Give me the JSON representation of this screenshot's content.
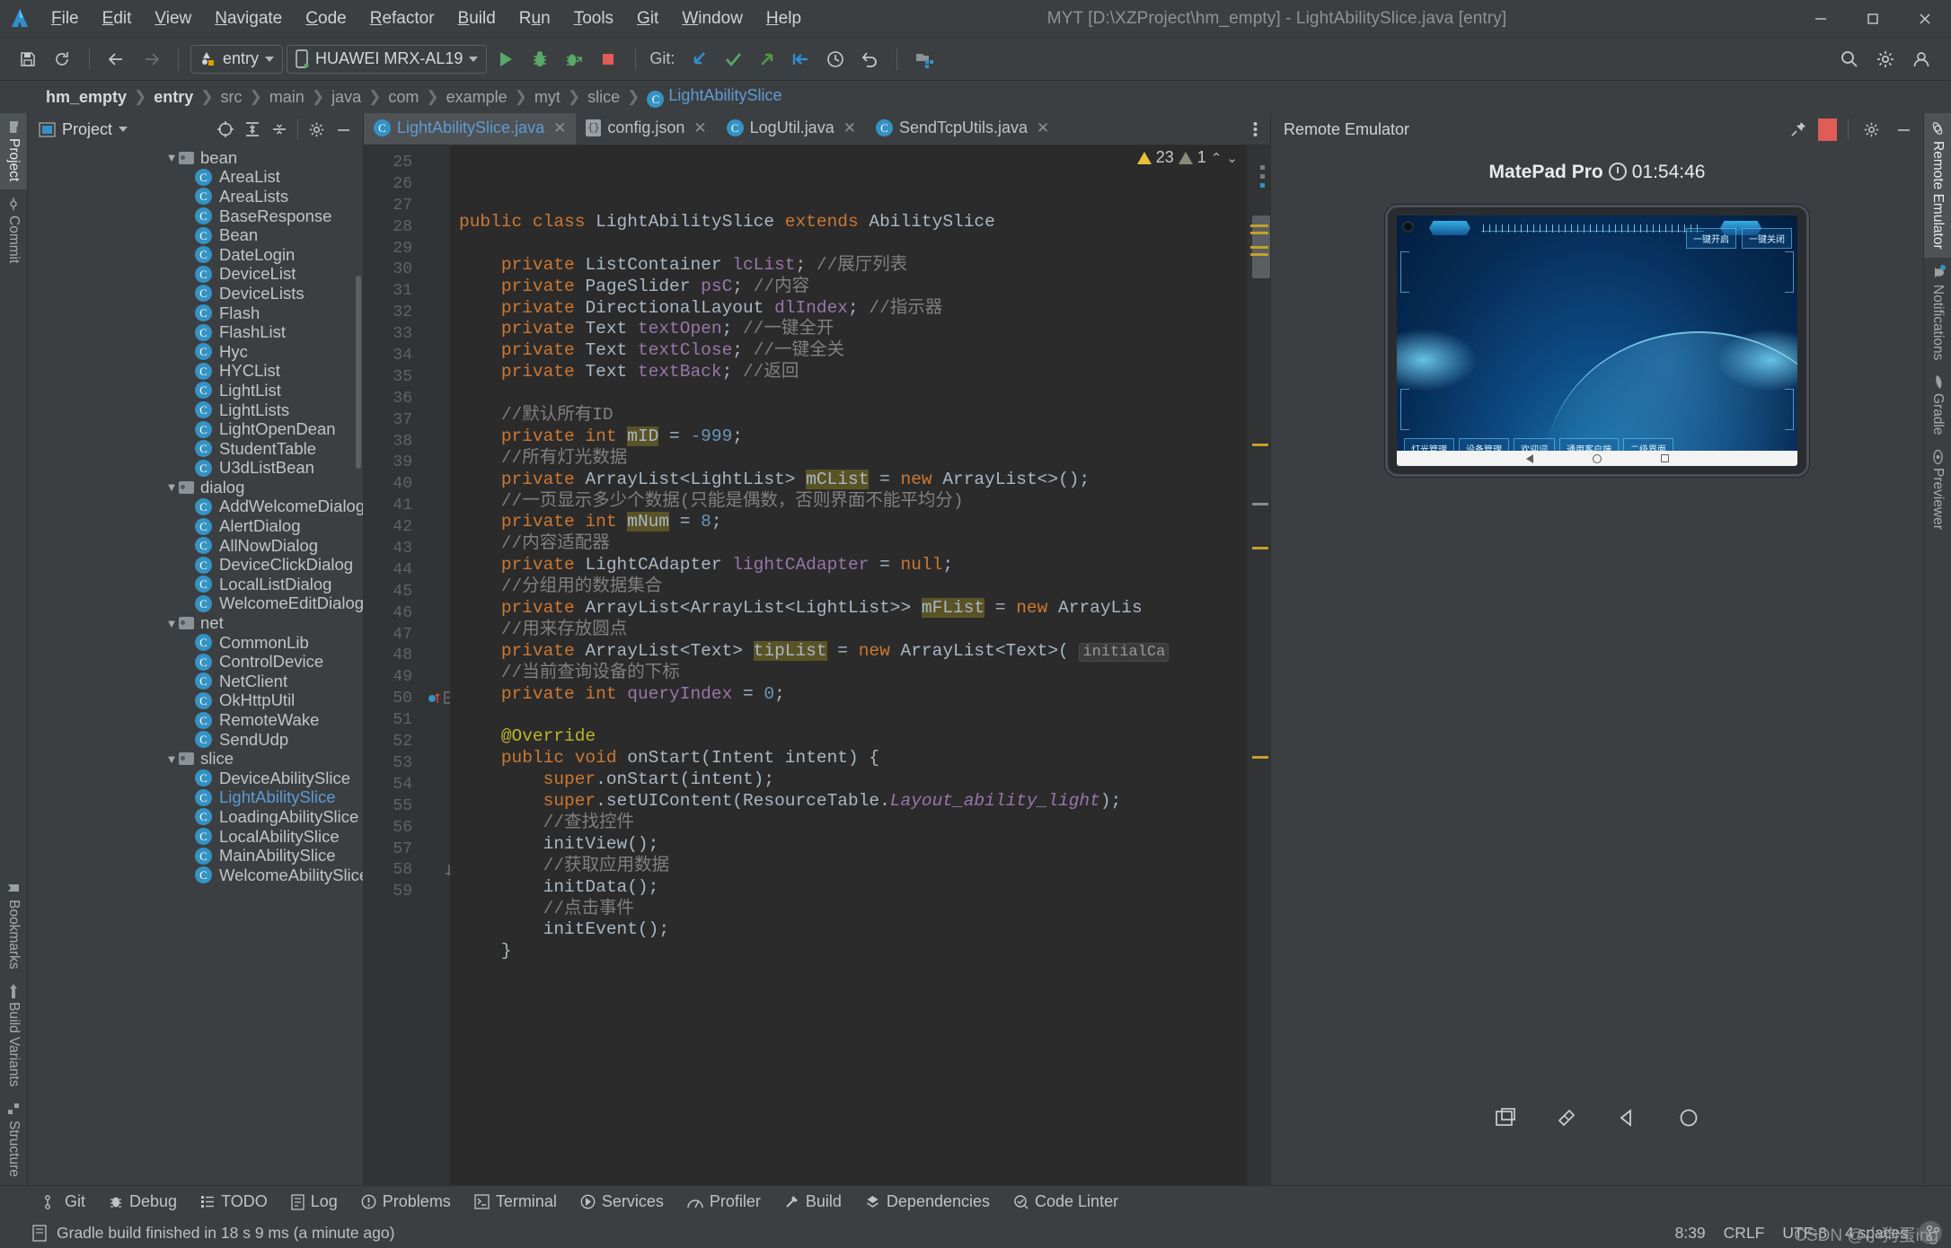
{
  "window": {
    "title": "MYT [D:\\XZProject\\hm_empty] - LightAbilitySlice.java [entry]",
    "minimize": "—",
    "maximize": "▢",
    "close": "✕"
  },
  "menu": [
    "File",
    "Edit",
    "View",
    "Navigate",
    "Code",
    "Refactor",
    "Build",
    "Run",
    "Tools",
    "Git",
    "Window",
    "Help"
  ],
  "toolbar": {
    "save_icon": "save-icon",
    "sync_icon": "sync-icon",
    "back_icon": "back-arrow-icon",
    "forward_icon": "forward-arrow-icon",
    "run_config": "entry",
    "device": "HUAWEI MRX-AL19",
    "run_icon": "run-icon",
    "debug_icon": "debug-icon",
    "debug_attach_icon": "attach-debugger-icon",
    "stop_icon": "stop-icon",
    "git_label": "Git:",
    "git_update_icon": "update-project-icon",
    "git_commit_icon": "commit-icon",
    "git_push_icon": "push-icon",
    "git_pull_icon": "pull-icon",
    "history_icon": "history-icon",
    "undo_icon": "undo-icon",
    "project_structure_icon": "project-structure-icon",
    "search_icon": "search-everywhere-icon",
    "settings_icon": "settings-icon",
    "account_icon": "account-icon"
  },
  "breadcrumb": [
    "hm_empty",
    "entry",
    "src",
    "main",
    "java",
    "com",
    "example",
    "myt",
    "slice",
    "LightAbilitySlice"
  ],
  "left_tabs": [
    {
      "label": "Project",
      "icon": "project-folder-icon",
      "active": true
    },
    {
      "label": "Commit",
      "icon": "commit-icon",
      "active": false
    },
    {
      "label": "Bookmarks",
      "icon": "bookmark-icon",
      "active": false
    },
    {
      "label": "Build Variants",
      "icon": "build-variants-icon",
      "active": false
    },
    {
      "label": "Structure",
      "icon": "structure-icon",
      "active": false
    }
  ],
  "right_tabs": [
    {
      "label": "Remote Emulator",
      "icon": "remote-emulator-icon",
      "active": true
    },
    {
      "label": "Notifications",
      "icon": "bell-icon",
      "active": false,
      "badge": true
    },
    {
      "label": "Gradle",
      "icon": "gradle-elephant-icon",
      "active": false
    },
    {
      "label": "Previewer",
      "icon": "eye-icon",
      "active": false
    }
  ],
  "project_panel": {
    "title": "Project",
    "select_icon": "select-opened-file-icon",
    "expand_icon": "expand-all-icon",
    "collapse_icon": "collapse-all-icon",
    "settings_icon": "gear-icon",
    "hide_icon": "hide-panel-icon",
    "tree": [
      {
        "label": "bean",
        "type": "folder",
        "depth": 1,
        "expanded": true
      },
      {
        "label": "AreaList",
        "type": "class",
        "depth": 2
      },
      {
        "label": "AreaLists",
        "type": "class",
        "depth": 2
      },
      {
        "label": "BaseResponse",
        "type": "class",
        "depth": 2
      },
      {
        "label": "Bean",
        "type": "class",
        "depth": 2
      },
      {
        "label": "DateLogin",
        "type": "class",
        "depth": 2
      },
      {
        "label": "DeviceList",
        "type": "class",
        "depth": 2
      },
      {
        "label": "DeviceLists",
        "type": "class",
        "depth": 2
      },
      {
        "label": "Flash",
        "type": "class",
        "depth": 2
      },
      {
        "label": "FlashList",
        "type": "class",
        "depth": 2
      },
      {
        "label": "Hyc",
        "type": "class",
        "depth": 2
      },
      {
        "label": "HYCList",
        "type": "class",
        "depth": 2
      },
      {
        "label": "LightList",
        "type": "class",
        "depth": 2
      },
      {
        "label": "LightLists",
        "type": "class",
        "depth": 2
      },
      {
        "label": "LightOpenDean",
        "type": "class",
        "depth": 2
      },
      {
        "label": "StudentTable",
        "type": "class",
        "depth": 2
      },
      {
        "label": "U3dListBean",
        "type": "class",
        "depth": 2
      },
      {
        "label": "dialog",
        "type": "folder",
        "depth": 1,
        "expanded": true
      },
      {
        "label": "AddWelcomeDialog",
        "type": "class",
        "depth": 2
      },
      {
        "label": "AlertDialog",
        "type": "class",
        "depth": 2
      },
      {
        "label": "AllNowDialog",
        "type": "class",
        "depth": 2
      },
      {
        "label": "DeviceClickDialog",
        "type": "class",
        "depth": 2
      },
      {
        "label": "LocalListDialog",
        "type": "class",
        "depth": 2
      },
      {
        "label": "WelcomeEditDialog",
        "type": "class",
        "depth": 2
      },
      {
        "label": "net",
        "type": "folder",
        "depth": 1,
        "expanded": true
      },
      {
        "label": "CommonLib",
        "type": "class",
        "depth": 2
      },
      {
        "label": "ControlDevice",
        "type": "class",
        "depth": 2
      },
      {
        "label": "NetClient",
        "type": "class",
        "depth": 2
      },
      {
        "label": "OkHttpUtil",
        "type": "class",
        "depth": 2
      },
      {
        "label": "RemoteWake",
        "type": "class",
        "depth": 2
      },
      {
        "label": "SendUdp",
        "type": "class",
        "depth": 2
      },
      {
        "label": "slice",
        "type": "folder",
        "depth": 1,
        "expanded": true
      },
      {
        "label": "DeviceAbilitySlice",
        "type": "class",
        "depth": 2
      },
      {
        "label": "LightAbilitySlice",
        "type": "class",
        "depth": 2,
        "selected": true
      },
      {
        "label": "LoadingAbilitySlice",
        "type": "class",
        "depth": 2
      },
      {
        "label": "LocalAbilitySlice",
        "type": "class",
        "depth": 2
      },
      {
        "label": "MainAbilitySlice",
        "type": "class",
        "depth": 2
      },
      {
        "label": "WelcomeAbilitySlice",
        "type": "class",
        "depth": 2
      }
    ]
  },
  "editor": {
    "tabs": [
      {
        "label": "LightAbilitySlice.java",
        "icon": "java-class-icon",
        "active": true,
        "close": "✕"
      },
      {
        "label": "config.json",
        "icon": "json-file-icon",
        "active": false,
        "close": "✕"
      },
      {
        "label": "LogUtil.java",
        "icon": "java-class-icon",
        "active": false,
        "close": "✕"
      },
      {
        "label": "SendTcpUtils.java",
        "icon": "java-class-icon",
        "active": false,
        "close": "✕"
      }
    ],
    "more_icon": "more-tabs-icon",
    "inspection": {
      "warning_count": "23",
      "weak_count": "1",
      "up": "⌃",
      "down": "⌄"
    },
    "first_line": 25,
    "lines": [
      {
        "n": 25,
        "html": "<span class=\"kw\">public class</span> <span class=\"cls\">LightAbilitySlice</span> <span class=\"kw\">extends</span> <span class=\"cls\">AbilitySlice</span>"
      },
      {
        "n": 26,
        "html": ""
      },
      {
        "n": 27,
        "html": "    <span class=\"kw\">private</span> <span class=\"cls\">ListContainer</span> <span class=\"fld\">lcList</span>; <span class=\"cmt\">//展厅列表</span>"
      },
      {
        "n": 28,
        "html": "    <span class=\"kw\">private</span> <span class=\"cls\">PageSlider</span> <span class=\"fld\">psC</span>; <span class=\"cmt\">//内容</span>"
      },
      {
        "n": 29,
        "html": "    <span class=\"kw\">private</span> <span class=\"cls\">DirectionalLayout</span> <span class=\"fld\">dlIndex</span>; <span class=\"cmt\">//指示器</span>"
      },
      {
        "n": 30,
        "html": "    <span class=\"kw\">private</span> <span class=\"cls\">Text</span> <span class=\"fld\">textOpen</span>; <span class=\"cmt\">//一键全开</span>"
      },
      {
        "n": 31,
        "html": "    <span class=\"kw\">private</span> <span class=\"cls\">Text</span> <span class=\"fld\">textClose</span>; <span class=\"cmt\">//一键全关</span>"
      },
      {
        "n": 32,
        "html": "    <span class=\"kw\">private</span> <span class=\"cls\">Text</span> <span class=\"fld\">textBack</span>; <span class=\"cmt\">//返回</span>"
      },
      {
        "n": 33,
        "html": ""
      },
      {
        "n": 34,
        "html": "    <span class=\"cmt\">//默认所有ID</span>"
      },
      {
        "n": 35,
        "html": "    <span class=\"kw\">private int</span> <span class=\"hl\">mID</span> = <span class=\"num\">-999</span>;"
      },
      {
        "n": 36,
        "html": "    <span class=\"cmt\">//所有灯光数据</span>"
      },
      {
        "n": 37,
        "html": "    <span class=\"kw\">private</span> <span class=\"cls\">ArrayList&lt;LightList&gt;</span> <span class=\"hl\">mCList</span> = <span class=\"kw\">new</span> <span class=\"cls\">ArrayList&lt;&gt;</span>();"
      },
      {
        "n": 38,
        "html": "    <span class=\"cmt\">//一页显示多少个数据(只能是偶数，否则界面不能平均分)</span>"
      },
      {
        "n": 39,
        "html": "    <span class=\"kw\">private int</span> <span class=\"hl\">mNum</span> = <span class=\"num\">8</span>;"
      },
      {
        "n": 40,
        "html": "    <span class=\"cmt\">//内容适配器</span>"
      },
      {
        "n": 41,
        "html": "    <span class=\"kw\">private</span> <span class=\"cls\">LightCAdapter</span> <span class=\"fld\">lightCAdapter</span> = <span class=\"kw\">null</span>;"
      },
      {
        "n": 42,
        "html": "    <span class=\"cmt\">//分组用的数据集合</span>"
      },
      {
        "n": 43,
        "html": "    <span class=\"kw\">private</span> <span class=\"cls\">ArrayList&lt;ArrayList&lt;LightList&gt;&gt;</span> <span class=\"hl\">mFList</span> = <span class=\"kw\">new</span> <span class=\"cls\">ArrayLis</span>"
      },
      {
        "n": 44,
        "html": "    <span class=\"cmt\">//用来存放圆点</span>"
      },
      {
        "n": 45,
        "html": "    <span class=\"kw\">private</span> <span class=\"cls\">ArrayList&lt;Text&gt;</span> <span class=\"hl\">tipList</span> = <span class=\"kw\">new</span> <span class=\"cls\">ArrayList&lt;Text&gt;</span>( <span class=\"param\">initialCa</span>"
      },
      {
        "n": 46,
        "html": "    <span class=\"cmt\">//当前查询设备的下标</span>"
      },
      {
        "n": 47,
        "html": "    <span class=\"kw\">private int</span> <span class=\"fld\">queryIndex</span> = <span class=\"num\">0</span>;"
      },
      {
        "n": 48,
        "html": ""
      },
      {
        "n": 49,
        "html": "    <span class=\"ann\">@Override</span>"
      },
      {
        "n": 50,
        "html": "    <span class=\"kw\">public void</span> <span class=\"cls\">onStart</span>(<span class=\"cls\">Intent</span> intent) {"
      },
      {
        "n": 51,
        "html": "        <span class=\"kw\">super</span>.onStart(intent);"
      },
      {
        "n": 52,
        "html": "        <span class=\"kw\">super</span>.setUIContent(<span class=\"cls\">ResourceTable</span>.<span class=\"ital\">Layout_ability_light</span>);"
      },
      {
        "n": 53,
        "html": "        <span class=\"cmt\">//查找控件</span>"
      },
      {
        "n": 54,
        "html": "        initView();"
      },
      {
        "n": 55,
        "html": "        <span class=\"cmt\">//获取应用数据</span>"
      },
      {
        "n": 56,
        "html": "        initData();"
      },
      {
        "n": 57,
        "html": "        <span class=\"cmt\">//点击事件</span>"
      },
      {
        "n": 58,
        "html": "        initEvent();"
      },
      {
        "n": 59,
        "html": "    }"
      }
    ]
  },
  "emulator": {
    "panel_title": "Remote Emulator",
    "pin_icon": "pin-icon",
    "stop_icon": "stop-session-icon",
    "settings_icon": "gear-icon",
    "hide_icon": "hide-panel-icon",
    "device_name": "MatePad Pro",
    "clock_icon": "clock-icon",
    "time_remaining": "01:54:46",
    "screen": {
      "top_buttons": [
        "一键开启",
        "一键关闭"
      ],
      "bottom_buttons": [
        "灯光管理",
        "设备管理",
        "欢迎词",
        "通用客户端",
        "二级界面"
      ],
      "nav": [
        "back",
        "home",
        "recents"
      ]
    },
    "footer_icons": [
      "screenshot-icon",
      "rotate-icon",
      "back-icon",
      "home-icon"
    ]
  },
  "bottom_tools": [
    {
      "label": "Git",
      "icon": "git-branch-icon"
    },
    {
      "label": "Debug",
      "icon": "debug-bug-icon"
    },
    {
      "label": "TODO",
      "icon": "todo-list-icon"
    },
    {
      "label": "Log",
      "icon": "log-icon"
    },
    {
      "label": "Problems",
      "icon": "problems-icon"
    },
    {
      "label": "Terminal",
      "icon": "terminal-icon"
    },
    {
      "label": "Services",
      "icon": "services-icon"
    },
    {
      "label": "Profiler",
      "icon": "profiler-icon"
    },
    {
      "label": "Build",
      "icon": "build-hammer-icon"
    },
    {
      "label": "Dependencies",
      "icon": "dependencies-icon"
    },
    {
      "label": "Code Linter",
      "icon": "code-linter-icon"
    }
  ],
  "status": {
    "message": "Gradle build finished in 18 s 9 ms (a minute ago)",
    "message_icon": "build-status-icon",
    "caret": "8:39",
    "line_separator": "CRLF",
    "encoding": "UTF-8",
    "indent": "4 spaces",
    "branch_icon": "git-branch-icon",
    "watermark": "CSDN @小狗蛋ing"
  },
  "colors": {
    "accent_blue": "#3592c4",
    "link_blue": "#5e9bd6",
    "panel_bg": "#3c3f41",
    "editor_bg": "#2b2b2b",
    "gutter_bg": "#313335",
    "warn_yellow": "#e8bf3a",
    "stop_red": "#e05c57",
    "run_green": "#59a869"
  }
}
